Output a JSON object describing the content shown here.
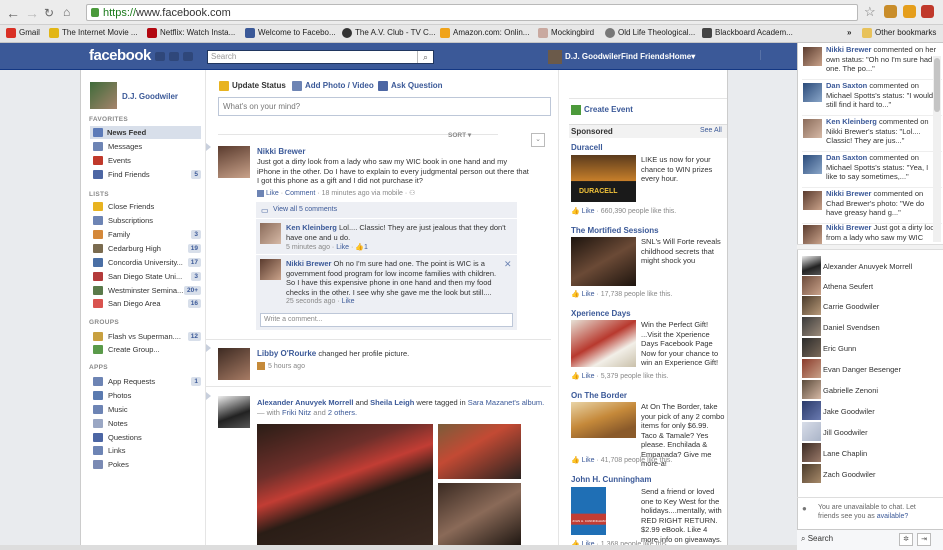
{
  "browser": {
    "url_scheme": "https://",
    "url_rest": "www.facebook.com",
    "bookmarks": [
      {
        "label": "Gmail",
        "color": "#d93025"
      },
      {
        "label": "The Internet Movie ...",
        "color": "#e2b616"
      },
      {
        "label": "Netflix: Watch Insta...",
        "color": "#b20710"
      },
      {
        "label": "Welcome to Facebo...",
        "color": "#3b5998"
      },
      {
        "label": "The A.V. Club - TV C...",
        "color": "#333333"
      },
      {
        "label": "Amazon.com: Onlin...",
        "color": "#f0a31a"
      },
      {
        "label": "Mockingbird",
        "color": "#999999"
      },
      {
        "label": "Old Life Theological...",
        "color": "#666666"
      },
      {
        "label": "Blackboard Academ...",
        "color": "#555555"
      }
    ],
    "overflow": "»",
    "other_bookmarks": "Other bookmarks"
  },
  "header": {
    "logo": "facebook",
    "search_placeholder": "Search",
    "user": "D.J. Goodwiler",
    "find_friends": "Find Friends",
    "home": "Home",
    "menu_arrow": "▾"
  },
  "leftnav": {
    "profile_name": "D.J. Goodwiler",
    "favorites_header": "FAVORITES",
    "favorites": [
      {
        "label": "News Feed",
        "color": "#5d7bb8",
        "count": ""
      },
      {
        "label": "Messages",
        "color": "#6d84b4",
        "count": ""
      },
      {
        "label": "Events",
        "color": "#c0392b",
        "count": ""
      },
      {
        "label": "Find Friends",
        "color": "#4c66a4",
        "count": "5"
      }
    ],
    "lists_header": "LISTS",
    "lists": [
      {
        "label": "Close Friends",
        "color": "#e8b320",
        "count": ""
      },
      {
        "label": "Subscriptions",
        "color": "#6d84b4",
        "count": ""
      },
      {
        "label": "Family",
        "color": "#d4883a",
        "count": "3"
      },
      {
        "label": "Cedarburg High",
        "color": "#7a6b4f",
        "count": "19"
      },
      {
        "label": "Concordia University...",
        "color": "#4a6fa5",
        "count": "17"
      },
      {
        "label": "San Diego State Uni...",
        "color": "#b33a3a",
        "count": "3"
      },
      {
        "label": "Westminster Semina...",
        "color": "#5a7a4a",
        "count": "20+"
      },
      {
        "label": "San Diego Area",
        "color": "#d9534f",
        "count": "16"
      }
    ],
    "groups_header": "GROUPS",
    "groups": [
      {
        "label": "Flash vs Superman....",
        "color": "#c8a040",
        "count": "12"
      },
      {
        "label": "Create Group...",
        "color": "#5a9a4a",
        "count": ""
      }
    ],
    "apps_header": "APPS",
    "apps": [
      {
        "label": "App Requests",
        "color": "#6d84b4",
        "count": "1"
      },
      {
        "label": "Photos",
        "color": "#5a7ab0",
        "count": ""
      },
      {
        "label": "Music",
        "color": "#6d84b4",
        "count": ""
      },
      {
        "label": "Notes",
        "color": "#9aa7c4",
        "count": ""
      },
      {
        "label": "Questions",
        "color": "#4c66a4",
        "count": ""
      },
      {
        "label": "Links",
        "color": "#6d84b4",
        "count": ""
      },
      {
        "label": "Pokes",
        "color": "#7a8ab4",
        "count": ""
      }
    ]
  },
  "composer": {
    "update_status": "Update Status",
    "add_photo": "Add Photo / Video",
    "ask_question": "Ask Question",
    "placeholder": "What's on your mind?",
    "sort": "SORT ▾"
  },
  "posts": {
    "p1": {
      "name": "Nikki Brewer",
      "text": "Just got a dirty look from a lady who saw my WIC book in one hand and my iPhone in the other. Do I have to explain to every judgmental person out there that I got this phone as a gift and I did not purchase it?",
      "like": "Like",
      "comment": "Comment",
      "time": "18 minutes ago via mobile",
      "view_all": "View all 5 comments",
      "comments": [
        {
          "name": "Ken Kleinberg",
          "text": "Lol.... Classic! They are just jealous that they don't have one and u do.",
          "time": "5 minutes ago",
          "like": "Like",
          "likes": "1"
        },
        {
          "name": "Nikki Brewer",
          "text": "Oh no I'm sure had one. The point is WIC is a government food program for low income families with children. So I have this expensive phone in one hand and then my food checks in the other. I see why she gave me the look but still....",
          "time": "25 seconds ago",
          "like": "Like"
        }
      ],
      "write_comment": "Write a comment..."
    },
    "p2": {
      "name": "Libby O'Rourke",
      "text": "changed her profile picture.",
      "time": "5 hours ago"
    },
    "p3": {
      "name1": "Alexander Anuvyek Morrell",
      "and": "and",
      "name2": "Sheila Leigh",
      "tagged": "were tagged in",
      "owner": "Sara Mazanet's",
      "album": "album.",
      "with": "— with",
      "with_name": "Friki Nitz",
      "and2": "and",
      "others": "2 others."
    }
  },
  "rightcol": {
    "create_event": "Create Event",
    "sponsored": "Sponsored",
    "see_all": "See All",
    "ads": [
      {
        "title": "Duracell",
        "text": "LIKE us now for your chance to WIN prizes every hour.",
        "like": "Like",
        "count": "660,390 people like this.",
        "img_label": "DURACELL"
      },
      {
        "title": "The Mortified Sessions",
        "text": "SNL's Will Forte reveals childhood secrets that might shock you",
        "like": "Like",
        "count": "17,738 people like this."
      },
      {
        "title": "Xperience Days",
        "text": "Win the Perfect Gift! ...Visit the Xperience Days Facebook Page Now for your chance to win an Experience Gift!",
        "like": "Like",
        "count": "5,379 people like this."
      },
      {
        "title": "On The Border",
        "text": "At On The Border, take your pick of any 2 combo items for only $6.99. Taco & Tamale? Yes please. Enchilada & Empanada? Give me more-a!",
        "like": "Like",
        "count": "41,708 people like this."
      },
      {
        "title": "John H. Cunningham",
        "text": "Send a friend or loved one to Key West for the holidays....mentally, with RED RIGHT RETURN. $2.99 eBook. Like 4 more info on giveaways.",
        "like": "Like",
        "count": "1,368 people like this.",
        "img_label": "JOHN H. CUNNINGHAM"
      }
    ]
  },
  "ticker": [
    {
      "name": "Nikki Brewer",
      "text": "commented on her own status: \"Oh no I'm sure had one. The po...\""
    },
    {
      "name": "Dan Saxton",
      "text": "commented on Michael Spotts's status: \"I would still find it hard to...\""
    },
    {
      "name": "Ken Kleinberg",
      "text": "commented on Nikki Brewer's status: \"Lol.... Classic! They are jus...\""
    },
    {
      "name": "Dan Saxton",
      "text": "commented on Michael Spotts's status: \"Yea, I like to say sometimes,...\""
    },
    {
      "name": "Nikki Brewer",
      "text": "commented on Chad Brewer's photo: \"We do have greasy hand g...\""
    },
    {
      "name": "Nikki Brewer",
      "text": "Just got a dirty look from a lady who saw my WIC book in one"
    }
  ],
  "chat": {
    "friends": [
      "Alexander Anuvyek Morrell",
      "Athena Seufert",
      "Carrie Goodwiler",
      "Daniel Svendsen",
      "Eric Gunn",
      "Evan Danger Besenger",
      "Gabrielle Zenoni",
      "Jake Goodwiler",
      "Jill Goodwiler",
      "Lane Chaplin",
      "Zach Goodwiler"
    ],
    "unavailable": "You are unavailable to chat. Let friends see you as",
    "available": "available?",
    "search": "Search"
  }
}
